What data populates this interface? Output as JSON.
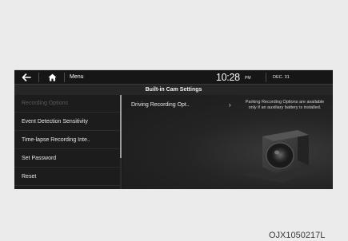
{
  "topbar": {
    "back_icon": "back-arrow-icon",
    "home_icon": "home-icon",
    "menu_label": "Menu",
    "time": "10:28",
    "ampm": "PM",
    "date": "DEC. 31"
  },
  "page": {
    "title": "Built-in Cam Settings"
  },
  "sidebar": {
    "items": [
      {
        "label": "Recording Options",
        "state": "disabled"
      },
      {
        "label": "Event Detection Sensitivity",
        "state": "enabled"
      },
      {
        "label": "Time-lapse Recording Inte..",
        "state": "enabled"
      },
      {
        "label": "Set Password",
        "state": "enabled"
      },
      {
        "label": "Reset",
        "state": "enabled"
      }
    ]
  },
  "content": {
    "item_label": "Driving Recording Opt..",
    "chevron": "›",
    "notice": "Parking Recording Options are available only if an auxiliary battery is installed.",
    "illustration": "camera-icon"
  },
  "watermark": "OJX1050217L",
  "colors": {
    "screen_bg": "#1c1c1c",
    "title_bar": "#262626",
    "text": "#e8e8e8",
    "disabled_text": "#5a5a5a",
    "page_bg": "#ebebeb"
  }
}
